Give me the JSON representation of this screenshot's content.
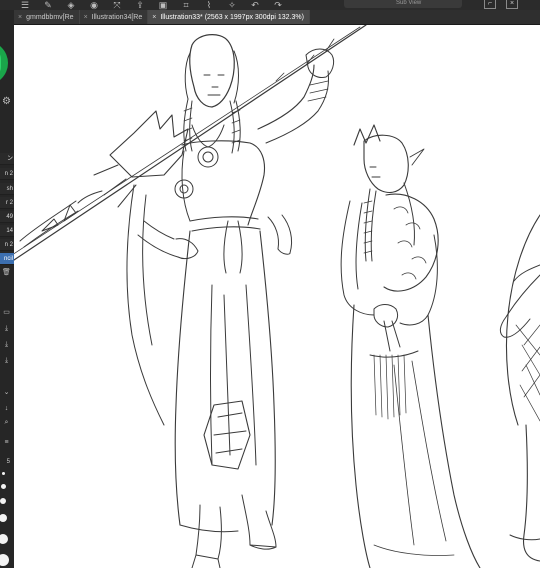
{
  "toolbar": {
    "icons": [
      "menu-icon",
      "pen-icon",
      "layer-icon",
      "eye-icon",
      "transform-icon",
      "export-icon",
      "folder-icon",
      "crop-icon",
      "brush-icon",
      "magic-wand-icon",
      "undo-icon",
      "redo-icon"
    ],
    "search_text": "Sub View"
  },
  "tabs": [
    {
      "label": "gmmdbbmv[Re"
    },
    {
      "label": "Illustration34[Re"
    },
    {
      "label": "Illustration33* (2563 x 1997px 300dpi 132.3%)",
      "active": true
    }
  ],
  "layers": [
    {
      "label": "ン"
    },
    {
      "label": "n 2"
    },
    {
      "label": "sh"
    },
    {
      "label": "r 2"
    },
    {
      "label": "49"
    },
    {
      "label": "14"
    },
    {
      "label": "n 2"
    },
    {
      "label": "ncil",
      "selected": true
    }
  ],
  "panel_numbers": [
    "5"
  ],
  "colors": {
    "active_tab": "#4a4a4a",
    "selected_layer": "#3c6fb0",
    "color_wheel": "#1aa64a"
  }
}
